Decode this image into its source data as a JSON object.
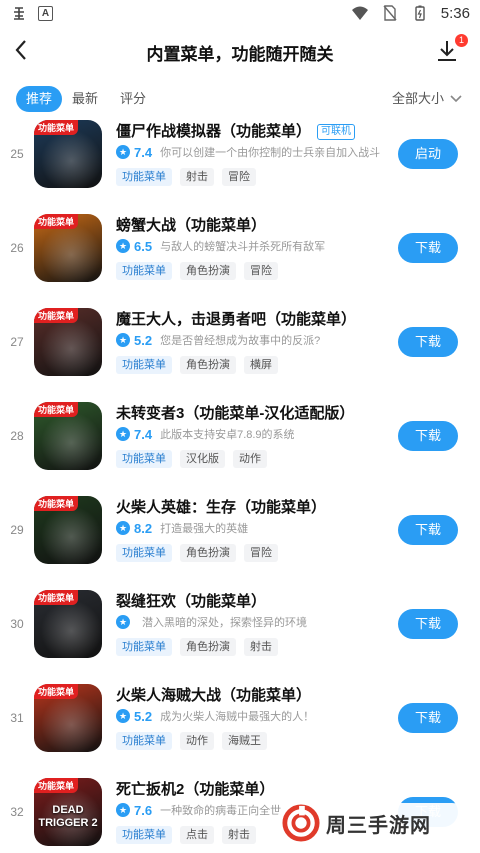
{
  "status_bar": {
    "time": "5:36",
    "left_icons": [
      "bug-icon",
      "a-box-icon"
    ],
    "right_icons": [
      "wifi-icon",
      "no-sim-icon",
      "battery-icon"
    ]
  },
  "header": {
    "title": "内置菜单，功能随开随关",
    "download_badge": "1"
  },
  "tabs": {
    "items": [
      "推荐",
      "最新",
      "评分"
    ],
    "active": "推荐",
    "size_filter": "全部大小"
  },
  "games": [
    {
      "rank": "25",
      "tag": "功能菜单",
      "name": "僵尸作战模拟器（功能菜单）",
      "online": "可联机",
      "score": "7.4",
      "desc": "你可以创建一个由你控制的士兵亲自加入战斗",
      "tags": [
        "功能菜单",
        "射击",
        "冒险"
      ],
      "action": "启动"
    },
    {
      "rank": "26",
      "tag": "功能菜单",
      "name": "螃蟹大战（功能菜单）",
      "online": "",
      "score": "6.5",
      "desc": "与敌人的螃蟹决斗并杀死所有敌军",
      "tags": [
        "功能菜单",
        "角色扮演",
        "冒险"
      ],
      "action": "下载"
    },
    {
      "rank": "27",
      "tag": "功能菜单",
      "name": "魔王大人，击退勇者吧（功能菜单）",
      "online": "",
      "score": "5.2",
      "desc": "您是否曾经想成为故事中的反派?",
      "tags": [
        "功能菜单",
        "角色扮演",
        "横屏"
      ],
      "action": "下载"
    },
    {
      "rank": "28",
      "tag": "功能菜单",
      "name": "未转变者3（功能菜单-汉化适配版）",
      "online": "",
      "score": "7.4",
      "desc": "此版本支持安卓7.8.9的系统",
      "tags": [
        "功能菜单",
        "汉化版",
        "动作"
      ],
      "action": "下载"
    },
    {
      "rank": "29",
      "tag": "功能菜单",
      "name": "火柴人英雄：生存（功能菜单）",
      "online": "",
      "score": "8.2",
      "desc": "打造最强大的英雄",
      "tags": [
        "功能菜单",
        "角色扮演",
        "冒险"
      ],
      "action": "下载"
    },
    {
      "rank": "30",
      "tag": "功能菜单",
      "name": "裂缝狂欢（功能菜单）",
      "online": "",
      "score": "",
      "desc": "潜入黑暗的深处，探索怪异的环境",
      "tags": [
        "功能菜单",
        "角色扮演",
        "射击"
      ],
      "action": "下载"
    },
    {
      "rank": "31",
      "tag": "功能菜单",
      "name": "火柴人海贼大战（功能菜单）",
      "online": "",
      "score": "5.2",
      "desc": "成为火柴人海贼中最强大的人！",
      "tags": [
        "功能菜单",
        "动作",
        "海贼王"
      ],
      "action": "下载"
    },
    {
      "rank": "32",
      "tag": "功能菜单",
      "name": "死亡扳机2（功能菜单）",
      "online": "",
      "score": "7.6",
      "desc": "一种致命的病毒正向全世",
      "tags": [
        "功能菜单",
        "点击",
        "射击"
      ],
      "action": "下载"
    }
  ],
  "thumb_colors": [
    "#1d3b5a",
    "#c76a16",
    "#5a2e2a",
    "#2f5b2c",
    "#1f3b1e",
    "#2a2d33",
    "#b9361d",
    "#7d1c1c"
  ],
  "thumb_logo_text": [
    "",
    "",
    "",
    "",
    "",
    "",
    "",
    "DEAD TRIGGER 2"
  ],
  "watermark": {
    "text": "周三手游网"
  },
  "colors": {
    "accent": "#2a9df4",
    "tag_red": "#e02020"
  }
}
